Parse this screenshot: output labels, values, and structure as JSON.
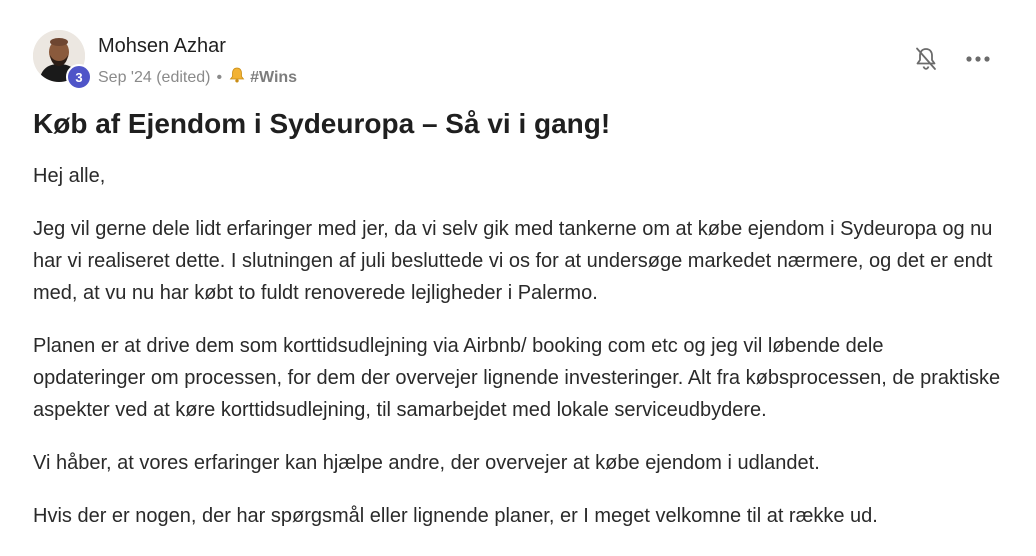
{
  "post": {
    "author": "Mohsen Azhar",
    "level": "3",
    "date": "Sep '24 (edited)",
    "separator": "•",
    "category": "#Wins",
    "title": "Køb af Ejendom i Sydeuropa – Så vi i gang!",
    "paragraphs": [
      "Hej alle,",
      "Jeg vil gerne dele lidt erfaringer med jer, da vi selv gik med tankerne om at købe ejendom i Sydeuropa og nu har vi realiseret dette. I slutningen af juli besluttede vi os for at undersøge markedet nærmere, og det er endt med, at vu nu har købt to fuldt renoverede lejligheder i Palermo.",
      "Planen er at drive dem som korttidsudlejning via Airbnb/ booking com etc og jeg vil løbende dele opdateringer om processen, for dem der overvejer lignende investeringer. Alt fra købsprocessen, de praktiske aspekter ved at køre korttidsudlejning, til samarbejdet med lokale serviceudbydere.",
      "Vi håber, at vores erfaringer kan hjælpe andre, der overvejer at købe ejendom i udlandet.",
      "Hvis der er nogen, der har spørgsmål eller lignende planer, er I meget velkomne til at række ud."
    ]
  },
  "icons": {
    "category_icon": "bell-icon",
    "mute": "bell-slash-icon",
    "more": "more-horizontal-icon"
  },
  "colors": {
    "badge": "#4f55c8",
    "text": "#1f1f1f",
    "muted": "#8a8a8a"
  }
}
